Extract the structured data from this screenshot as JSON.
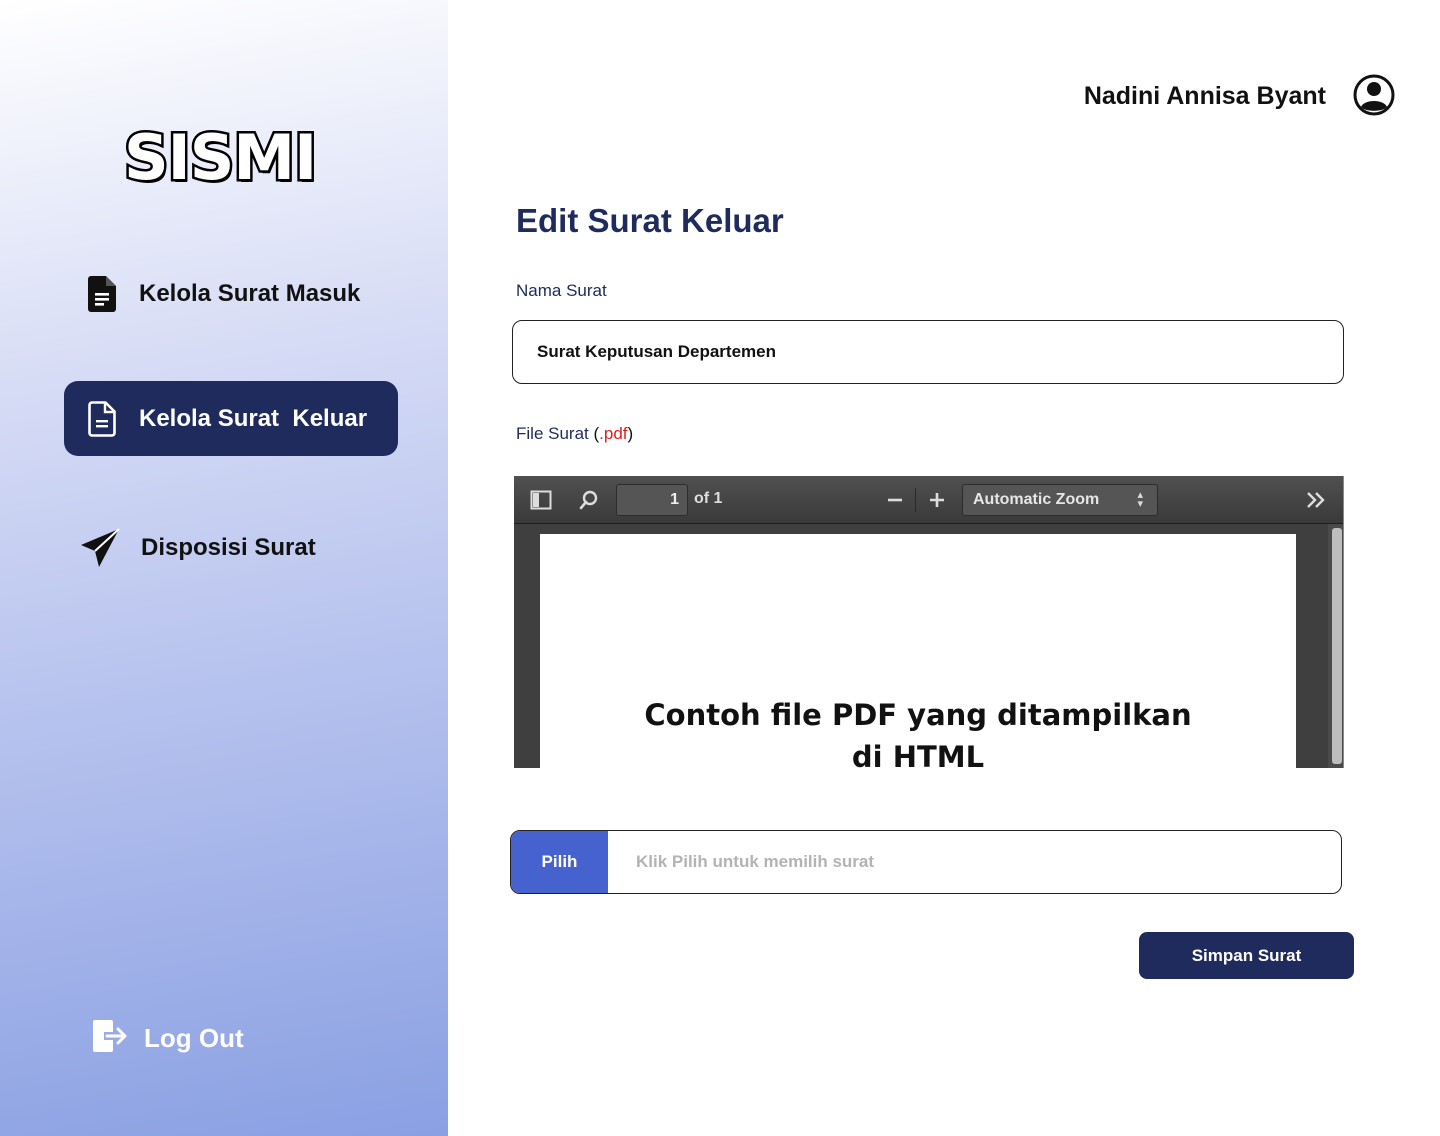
{
  "app": {
    "logo_text": "SISMI"
  },
  "sidebar": {
    "items": [
      {
        "label": "Kelola Surat Masuk",
        "icon": "document-filled-icon",
        "active": false
      },
      {
        "label": "Kelola Surat  Keluar",
        "icon": "document-outline-icon",
        "active": true
      },
      {
        "label": "Disposisi Surat",
        "icon": "paper-plane-icon",
        "active": false
      }
    ],
    "logout_label": "Log Out"
  },
  "header": {
    "user_name": "Nadini Annisa Byant",
    "avatar_icon": "user-circle-icon"
  },
  "main": {
    "title": "Edit Surat Keluar",
    "nama_label": "Nama Surat",
    "nama_value": "Surat Keputusan Departemen",
    "file_label_prefix": "File Surat ",
    "file_label_open": "(",
    "file_label_ext": ".pdf",
    "file_label_close": ")",
    "pdf_viewer": {
      "page_input": "1",
      "page_count": "of 1",
      "zoom": "Automatic Zoom",
      "content_line1": "Contoh file PDF yang ditampilkan",
      "content_line2": "di HTML"
    },
    "picker_button": "Pilih",
    "picker_placeholder": "Klik Pilih untuk memilih surat",
    "save_button": "Simpan Surat"
  },
  "colors": {
    "primary": "#1e2b5c",
    "pick_button": "#4662cf",
    "ext_red": "#e02020"
  }
}
